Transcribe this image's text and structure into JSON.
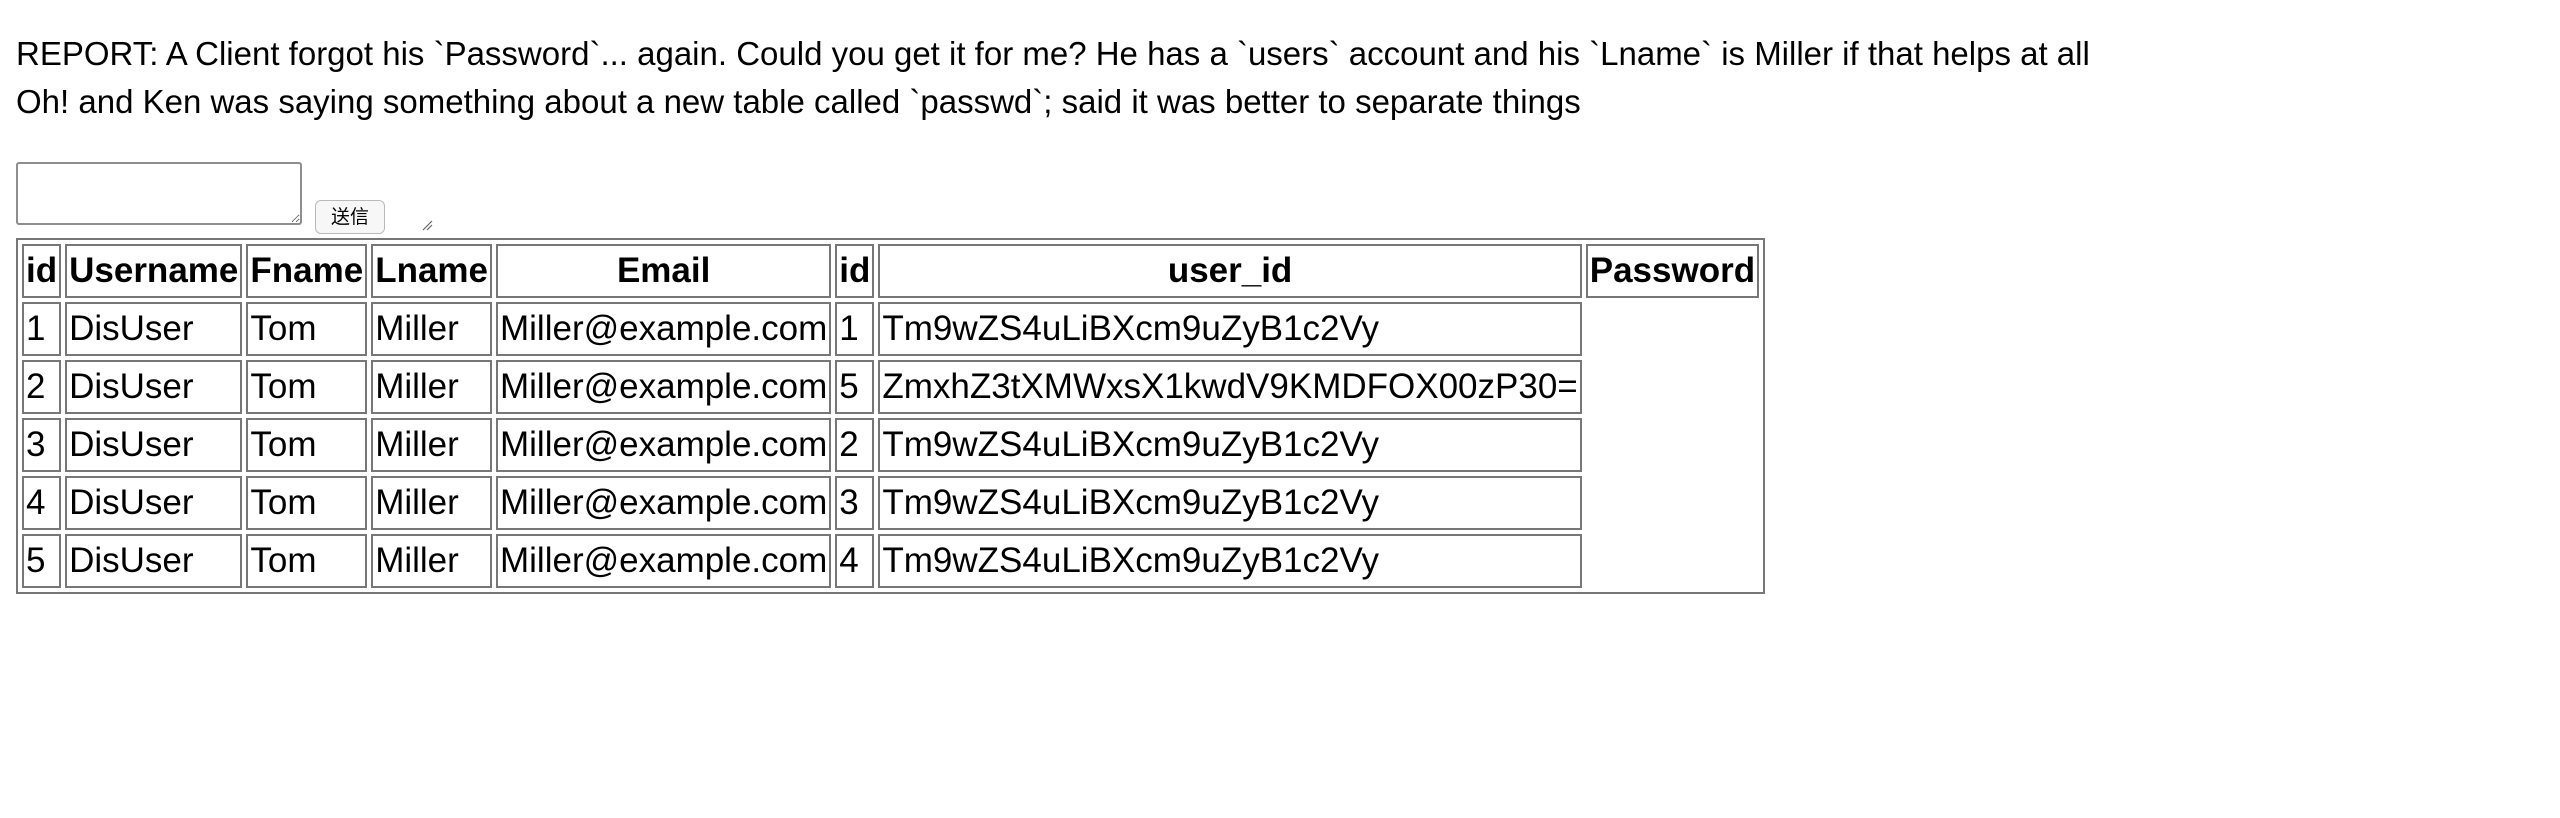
{
  "report": {
    "line1": "REPORT: A Client forgot his `Password`... again. Could you get it for me? He has a `users` account and his `Lname` is Miller if that helps at all",
    "line2": "Oh! and Ken was saying something about a new table called `passwd`; said it was better to separate things"
  },
  "form": {
    "query_value": "",
    "submit_label": "送信"
  },
  "table": {
    "headers": [
      "id",
      "Username",
      "Fname",
      "Lname",
      "Email",
      "id",
      "user_id",
      "Password"
    ],
    "rows": [
      [
        "1",
        "DisUser",
        "Tom",
        "Miller",
        "Miller@example.com",
        "1",
        "Tm9wZS4uLiBXcm9uZyB1c2Vy",
        ""
      ],
      [
        "2",
        "DisUser",
        "Tom",
        "Miller",
        "Miller@example.com",
        "5",
        "ZmxhZ3tXMWxsX1kwdV9KMDFOX00zP30=",
        ""
      ],
      [
        "3",
        "DisUser",
        "Tom",
        "Miller",
        "Miller@example.com",
        "2",
        "Tm9wZS4uLiBXcm9uZyB1c2Vy",
        ""
      ],
      [
        "4",
        "DisUser",
        "Tom",
        "Miller",
        "Miller@example.com",
        "3",
        "Tm9wZS4uLiBXcm9uZyB1c2Vy",
        ""
      ],
      [
        "5",
        "DisUser",
        "Tom",
        "Miller",
        "Miller@example.com",
        "4",
        "Tm9wZS4uLiBXcm9uZyB1c2Vy",
        ""
      ]
    ]
  }
}
